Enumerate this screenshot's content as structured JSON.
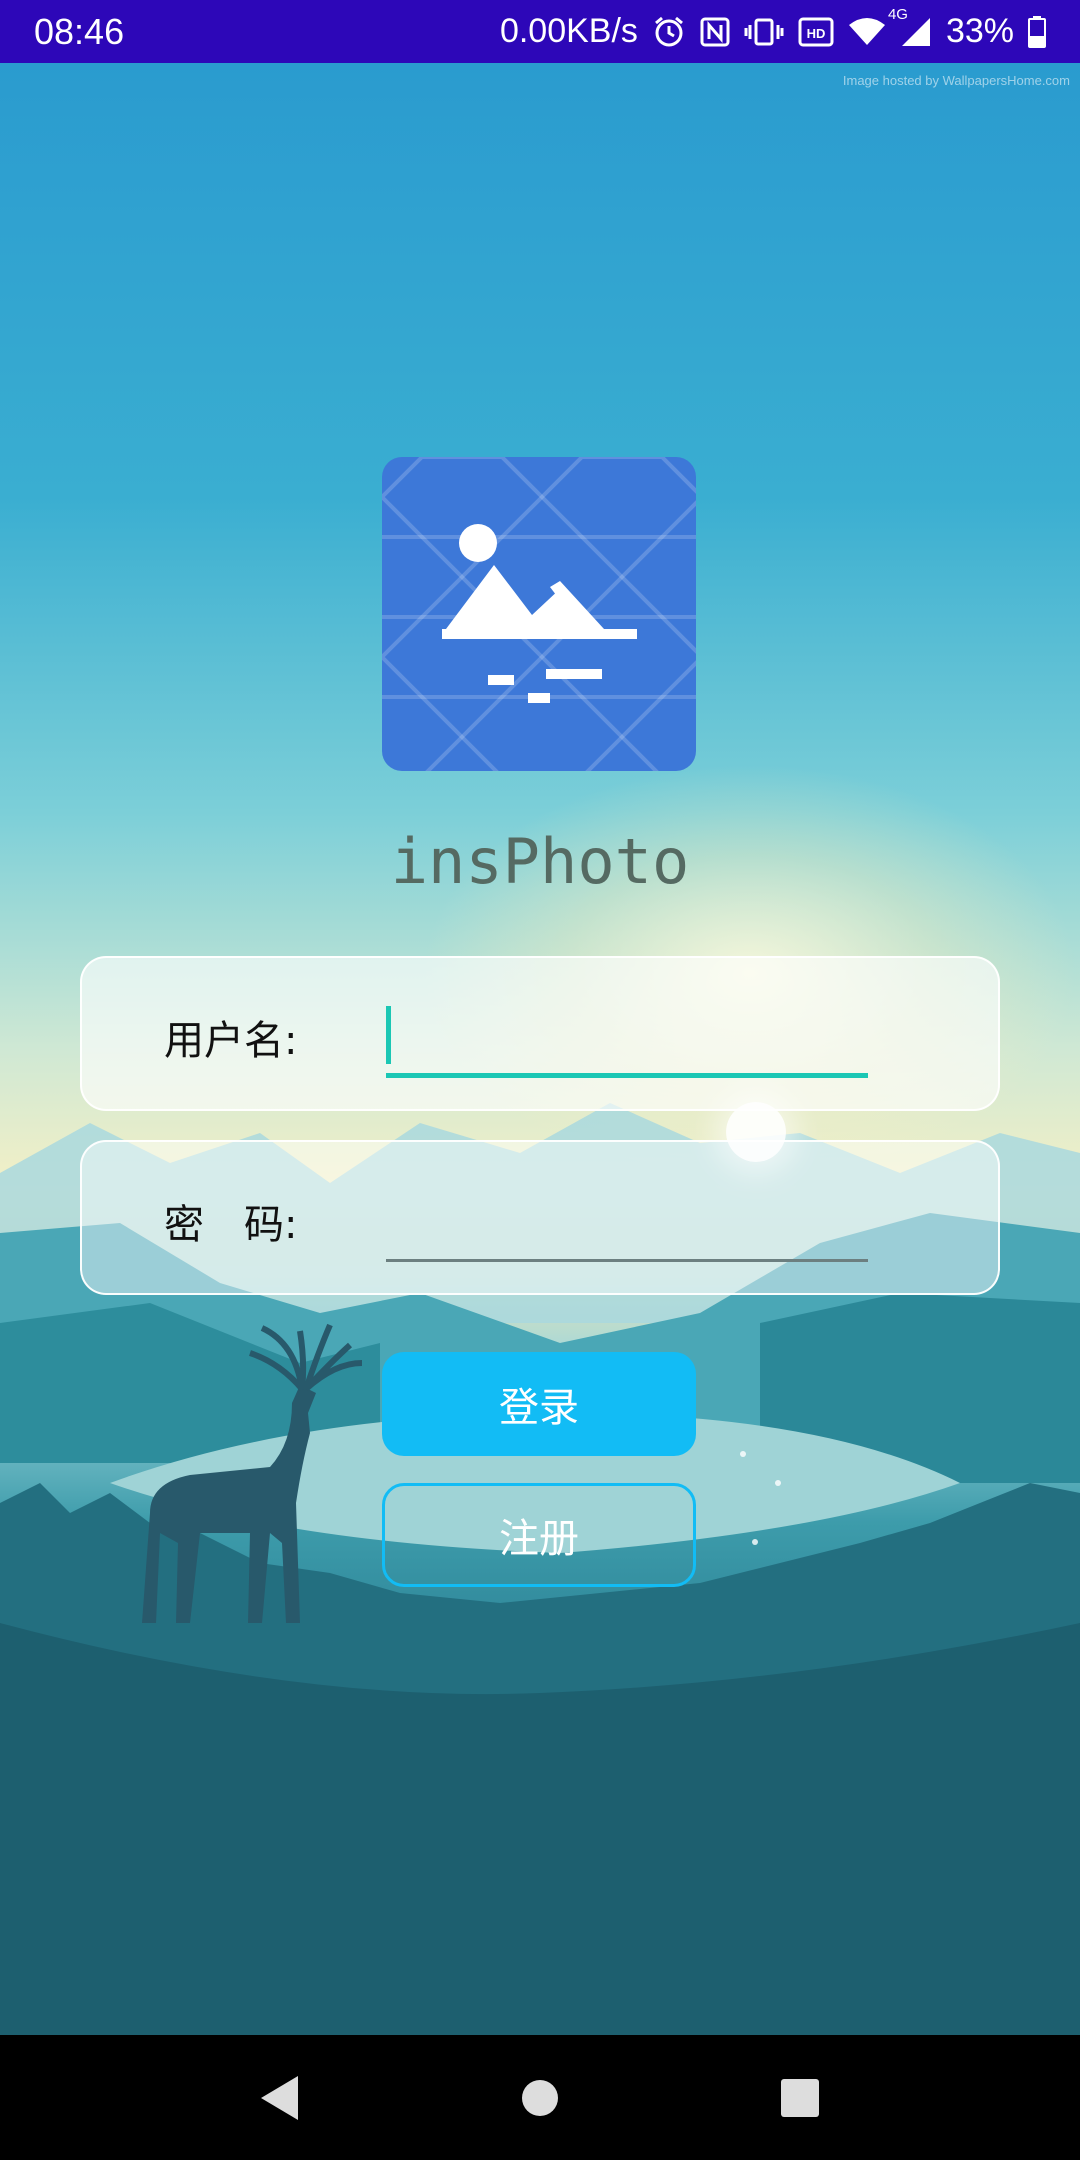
{
  "status_bar": {
    "time": "08:46",
    "net_speed": "0.00KB/s",
    "network_type": "4G",
    "battery": "33%",
    "icons": [
      "alarm-icon",
      "nfc-icon",
      "vibrate-icon",
      "hd-icon",
      "wifi-icon",
      "signal-icon",
      "battery-icon"
    ]
  },
  "background": {
    "watermark": "Image hosted by WallpapersHome.com"
  },
  "app": {
    "logo_icon": "image-mountain-icon",
    "name": "insPhoto"
  },
  "login_form": {
    "username_label": "用户名:",
    "username_value": "",
    "password_label": "密　码:",
    "password_value": ""
  },
  "buttons": {
    "login": "登录",
    "register": "注册"
  },
  "nav_bar": {
    "icons": [
      "back-icon",
      "home-icon",
      "recents-icon"
    ]
  },
  "colors": {
    "status_bar": "#2d07b8",
    "logo_bg": "#3d78d8",
    "accent": "#12bcf5",
    "input_focus": "#1bc7b4"
  }
}
